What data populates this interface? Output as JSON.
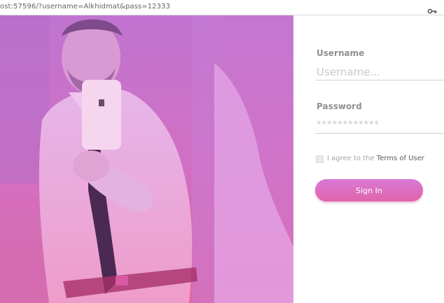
{
  "address_bar": {
    "url": "ost:57596/?username=Alkhidmat&pass=12333",
    "key_icon": "key-icon"
  },
  "hero": {
    "image": "man-selfie-photo",
    "overlay_colors": [
      "#c27ad0",
      "#d474c5",
      "#e06aa8"
    ]
  },
  "form": {
    "username_label": "Username",
    "username_placeholder": "Username...",
    "password_label": "Password",
    "password_value": "************",
    "agree_text": "I agree to the ",
    "terms_link": "Terms of User",
    "signin_label": "Sign In",
    "accent_colors": [
      "#d879d6",
      "#e164ab"
    ]
  }
}
